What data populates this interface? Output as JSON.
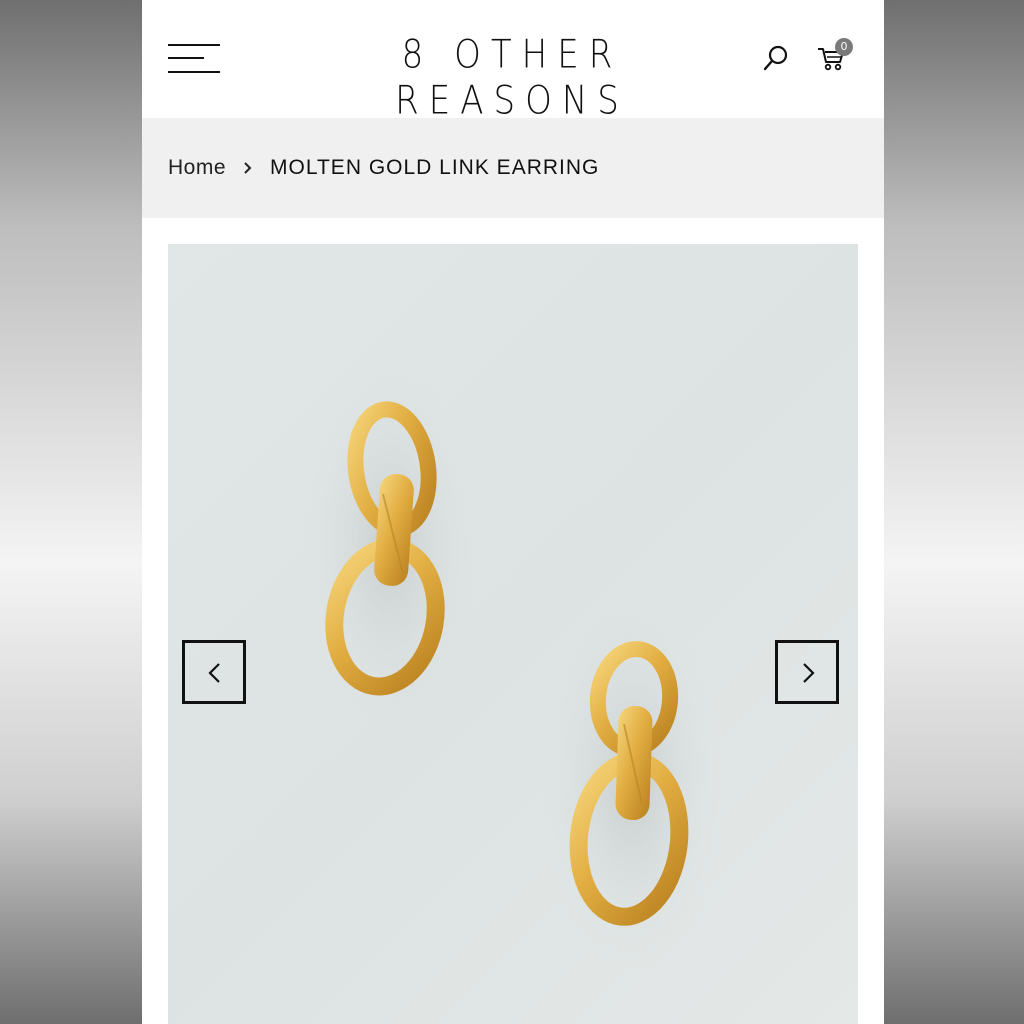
{
  "brand": {
    "logo_text": "8 OTHER REASONS"
  },
  "header": {
    "cart_count": "0",
    "menu_icon": "hamburger-icon",
    "search_icon": "search-icon",
    "cart_icon": "cart-icon"
  },
  "breadcrumb": {
    "home": "Home",
    "separator_icon": "chevron-right-icon",
    "current": "MOLTEN GOLD LINK EARRING"
  },
  "gallery": {
    "image_subject": "gold link earrings",
    "prev_icon": "chevron-left-icon",
    "next_icon": "chevron-right-icon"
  },
  "colors": {
    "accent": "#111111",
    "breadcrumb_bg": "#f0f0f0",
    "image_bg": "#e0e5e5",
    "gold": "#e3b34a"
  }
}
